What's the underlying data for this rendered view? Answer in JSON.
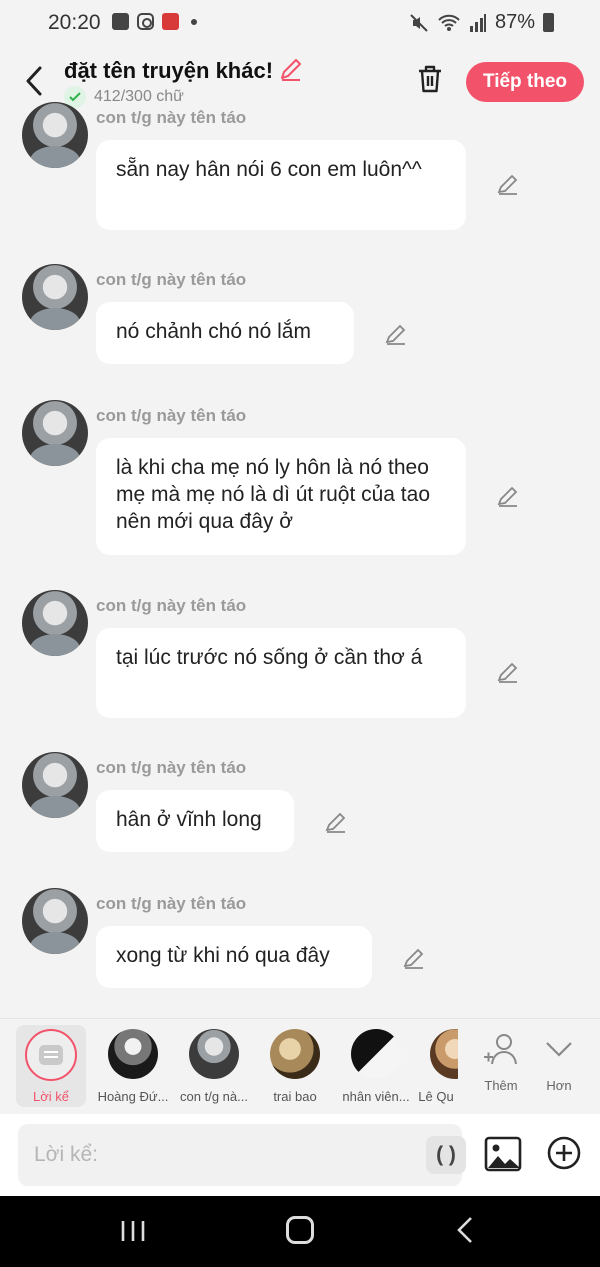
{
  "status_bar": {
    "time": "20:20",
    "battery": "87%"
  },
  "header": {
    "title": "đặt tên truyện khác!",
    "char_count": "412/300 chữ",
    "next_label": "Tiếp theo"
  },
  "messages": [
    {
      "name": "con t/g này tên táo",
      "text": "sẵn nay hân nói 6 con em luôn^^"
    },
    {
      "name": "con t/g này tên táo",
      "text": "nó chảnh chó nó lắm"
    },
    {
      "name": "con t/g này tên táo",
      "text": "là khi cha mẹ nó ly hôn là nó theo mẹ mà mẹ nó là dì út ruột của tao nên mới qua đây ở"
    },
    {
      "name": "con t/g này tên táo",
      "text": "tại lúc trước nó sống ở cần thơ á"
    },
    {
      "name": "con t/g này tên táo",
      "text": "hân ở vĩnh long"
    },
    {
      "name": "con t/g này tên táo",
      "text": "xong từ khi nó qua đây"
    }
  ],
  "characters": [
    {
      "label": "Lời kể"
    },
    {
      "label": "Hoàng Đứ..."
    },
    {
      "label": "con t/g nà..."
    },
    {
      "label": "trai bao"
    },
    {
      "label": "nhân viên..."
    },
    {
      "label": "Lê Qu"
    }
  ],
  "tools": {
    "add_label": "Thêm",
    "more_label": "Hơn"
  },
  "composer": {
    "placeholder": "Lời kể:",
    "paren": "( )"
  },
  "colors": {
    "accent": "#f2536a",
    "bubble": "#ffffff",
    "background": "#f3f3f3"
  }
}
